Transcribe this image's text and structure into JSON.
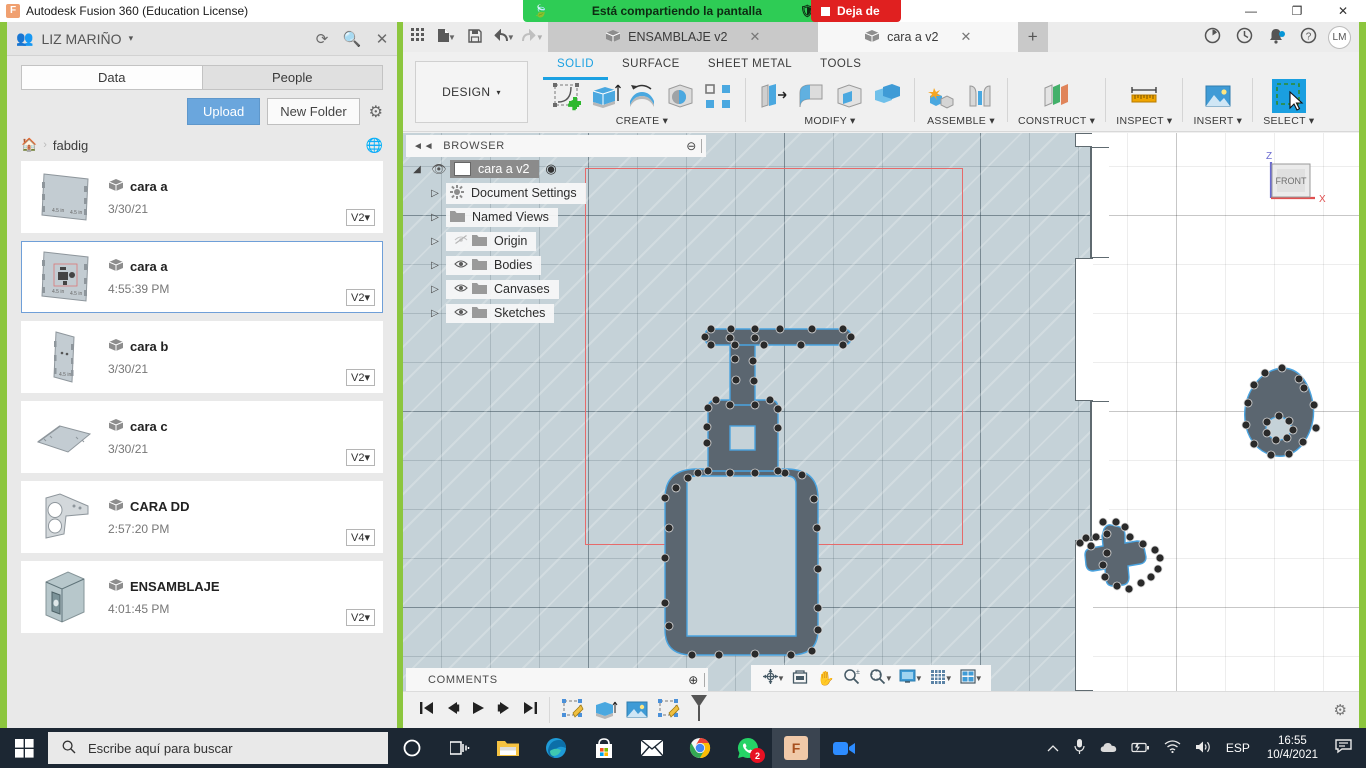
{
  "window": {
    "app_title": "Autodesk Fusion 360 (Education License)",
    "app_icon": "fusion-icon",
    "minimize": "—",
    "maximize": "❐",
    "close": "✕"
  },
  "screen_share": {
    "message": "Está compartiendo la pantalla",
    "leaf_icon": "leaf-icon",
    "shield_icon": "shield-icon",
    "stop_label": "Deja de",
    "banner_color": "#2ecc55",
    "stop_color": "#e02020"
  },
  "data_panel": {
    "user_name": "LIZ MARIÑO",
    "caret": "▾",
    "refresh_icon": "refresh-icon",
    "search_icon": "search-icon",
    "close_icon": "close-icon",
    "tabs": [
      {
        "label": "Data",
        "active": true
      },
      {
        "label": "People",
        "active": false
      }
    ],
    "upload_label": "Upload",
    "new_folder_label": "New Folder",
    "settings_icon": "gear-icon",
    "home_icon": "home-icon",
    "breadcrumb_sep": "›",
    "breadcrumb": "fabdig",
    "globe_icon": "globe-icon",
    "files": [
      {
        "name": "cara a",
        "date": "3/30/21",
        "version": "V2",
        "selected": false,
        "thumb": "panel-flat"
      },
      {
        "name": "cara a",
        "date": "4:55:39 PM",
        "version": "V2",
        "selected": true,
        "thumb": "panel-sketch"
      },
      {
        "name": "cara b",
        "date": "3/30/21",
        "version": "V2",
        "selected": false,
        "thumb": "panel-tall"
      },
      {
        "name": "cara c",
        "date": "3/30/21",
        "version": "V2",
        "selected": false,
        "thumb": "panel-wide"
      },
      {
        "name": "CARA DD",
        "date": "2:57:20 PM",
        "version": "V4",
        "selected": false,
        "thumb": "bracket"
      },
      {
        "name": "ENSAMBLAJE",
        "date": "4:01:45 PM",
        "version": "V2",
        "selected": false,
        "thumb": "assembly-box"
      }
    ],
    "version_caret": "▾"
  },
  "fusion": {
    "quick_access": [
      {
        "name": "app-grid-icon",
        "glyph": "⠿"
      },
      {
        "name": "new-file-icon",
        "glyph": "🗋"
      },
      {
        "name": "save-icon",
        "glyph": "🖫"
      },
      {
        "name": "undo-icon",
        "glyph": "↩"
      },
      {
        "name": "redo-icon",
        "glyph": "↪"
      }
    ],
    "doc_tabs": [
      {
        "label": "ENSAMBLAJE v2",
        "active": false,
        "close": "✕"
      },
      {
        "label": "cara a v2",
        "active": true,
        "close": "✕"
      }
    ],
    "new_tab": "+",
    "right_icons": [
      {
        "name": "job-status-icon",
        "glyph": "◔"
      },
      {
        "name": "recent-history-icon",
        "glyph": "🕔"
      },
      {
        "name": "notifications-icon",
        "glyph": "🔔"
      },
      {
        "name": "help-icon",
        "glyph": "?"
      }
    ],
    "avatar_initials": "LM",
    "workspace_label": "DESIGN",
    "workspace_caret": "▾",
    "ws_tabs": [
      {
        "label": "SOLID",
        "selected": true
      },
      {
        "label": "SURFACE",
        "selected": false
      },
      {
        "label": "SHEET METAL",
        "selected": false
      },
      {
        "label": "TOOLS",
        "selected": false
      }
    ],
    "ribbon_groups": [
      {
        "label": "CREATE",
        "caret": "▾",
        "icons": [
          "create-sketch-icon",
          "extrude-icon",
          "revolve-icon",
          "hole-icon",
          "pattern-icon"
        ]
      },
      {
        "label": "MODIFY",
        "caret": "▾",
        "icons": [
          "press-pull-icon",
          "fillet-icon",
          "shell-icon",
          "combine-icon"
        ]
      },
      {
        "label": "ASSEMBLE",
        "caret": "▾",
        "icons": [
          "new-component-icon",
          "joint-icon"
        ]
      },
      {
        "label": "CONSTRUCT",
        "caret": "▾",
        "icons": [
          "offset-plane-icon"
        ]
      },
      {
        "label": "INSPECT",
        "caret": "▾",
        "icons": [
          "measure-icon"
        ]
      },
      {
        "label": "INSERT",
        "caret": "▾",
        "icons": [
          "insert-canvas-icon"
        ]
      },
      {
        "label": "SELECT",
        "caret": "▾",
        "icons": [
          "select-window-icon"
        ]
      }
    ],
    "browser": {
      "title": "BROWSER",
      "collapse_icon": "collapse-left-icon",
      "minimize_icon": "minimize-icon",
      "root": {
        "label": "cara a v2",
        "eye": "👁",
        "target_icon": "target-icon",
        "arrow": "◢"
      },
      "nodes": [
        {
          "label": "Document Settings",
          "icon": "gear-icon",
          "eye": false,
          "arrow": "▷"
        },
        {
          "label": "Named Views",
          "icon": "folder-icon",
          "eye": false,
          "arrow": "▷"
        },
        {
          "label": "Origin",
          "icon": "folder-icon",
          "eye": "hidden",
          "arrow": "▷"
        },
        {
          "label": "Bodies",
          "icon": "folder-icon",
          "eye": true,
          "arrow": "▷"
        },
        {
          "label": "Canvases",
          "icon": "folder-icon",
          "eye": true,
          "arrow": "▷"
        },
        {
          "label": "Sketches",
          "icon": "folder-icon",
          "eye": true,
          "arrow": "▷"
        }
      ]
    },
    "viewcube": {
      "face": "FRONT",
      "axis_z": "Z",
      "axis_x": "X",
      "z_color": "#6a6ad0",
      "x_color": "#e05050"
    },
    "comments": {
      "label": "COMMENTS",
      "add_icon": "add-comment-icon"
    },
    "nav_bar": [
      {
        "name": "orbit-icon",
        "glyph": "✥",
        "caret": "▾"
      },
      {
        "name": "look-at-icon",
        "glyph": "▤",
        "caret": ""
      },
      {
        "name": "pan-icon",
        "glyph": "✋",
        "caret": ""
      },
      {
        "name": "zoom-icon",
        "glyph": "🔍",
        "caret": ""
      },
      {
        "name": "fit-icon",
        "glyph": "🔍",
        "caret": "▾"
      },
      {
        "name": "display-settings-icon",
        "glyph": "🖵",
        "caret": "▾"
      },
      {
        "name": "grid-snaps-icon",
        "glyph": "▦",
        "caret": "▾"
      },
      {
        "name": "viewports-icon",
        "glyph": "◫",
        "caret": "▾"
      }
    ],
    "timeline": {
      "playback": [
        {
          "name": "timeline-begin-icon",
          "glyph": "◀|"
        },
        {
          "name": "timeline-prev-icon",
          "glyph": "◀"
        },
        {
          "name": "timeline-play-icon",
          "glyph": "▶"
        },
        {
          "name": "timeline-next-icon",
          "glyph": "▶"
        },
        {
          "name": "timeline-end-icon",
          "glyph": "|▶"
        }
      ],
      "features": [
        "sketch-feature-icon",
        "extrude-feature-icon",
        "canvas-feature-icon",
        "sketch2-feature-icon"
      ],
      "settings_icon": "gear-icon"
    },
    "canvas": {
      "sketch_name": "soap-dispenser-sketch",
      "plane_color": "#c5d2d8",
      "curve_color": "#4aa3df",
      "profile_color": "#5b6670",
      "boundary_color": "#e66a6a"
    }
  },
  "taskbar": {
    "start_icon": "windows-start-icon",
    "search_placeholder": "Escribe aquí para buscar",
    "search_icon": "search-icon",
    "apps": [
      {
        "name": "cortana-icon",
        "glyph": "◯",
        "active": false
      },
      {
        "name": "task-view-icon",
        "glyph": "❏",
        "active": false
      },
      {
        "name": "file-explorer-icon",
        "glyph": "🗀",
        "active": false
      },
      {
        "name": "edge-icon",
        "glyph": "◉",
        "active": false
      },
      {
        "name": "microsoft-store-icon",
        "glyph": "🛍",
        "active": false
      },
      {
        "name": "mail-icon",
        "glyph": "✉",
        "active": false
      },
      {
        "name": "chrome-icon",
        "glyph": "◉",
        "active": false
      },
      {
        "name": "whatsapp-icon",
        "glyph": "✆",
        "active": false,
        "badge": "2"
      },
      {
        "name": "fusion360-icon",
        "glyph": "F",
        "active": true
      },
      {
        "name": "zoom-icon",
        "glyph": "▣",
        "active": false
      }
    ],
    "tray": [
      {
        "name": "show-hidden-icons-icon",
        "glyph": "︿"
      },
      {
        "name": "microphone-icon",
        "glyph": "🎤"
      },
      {
        "name": "onedrive-icon",
        "glyph": "☁"
      },
      {
        "name": "battery-icon",
        "glyph": "🔋"
      },
      {
        "name": "wifi-icon",
        "glyph": "📶"
      },
      {
        "name": "volume-icon",
        "glyph": "🔊"
      }
    ],
    "language": "ESP",
    "time": "16:55",
    "date": "10/4/2021",
    "action_center_icon": "action-center-icon"
  }
}
